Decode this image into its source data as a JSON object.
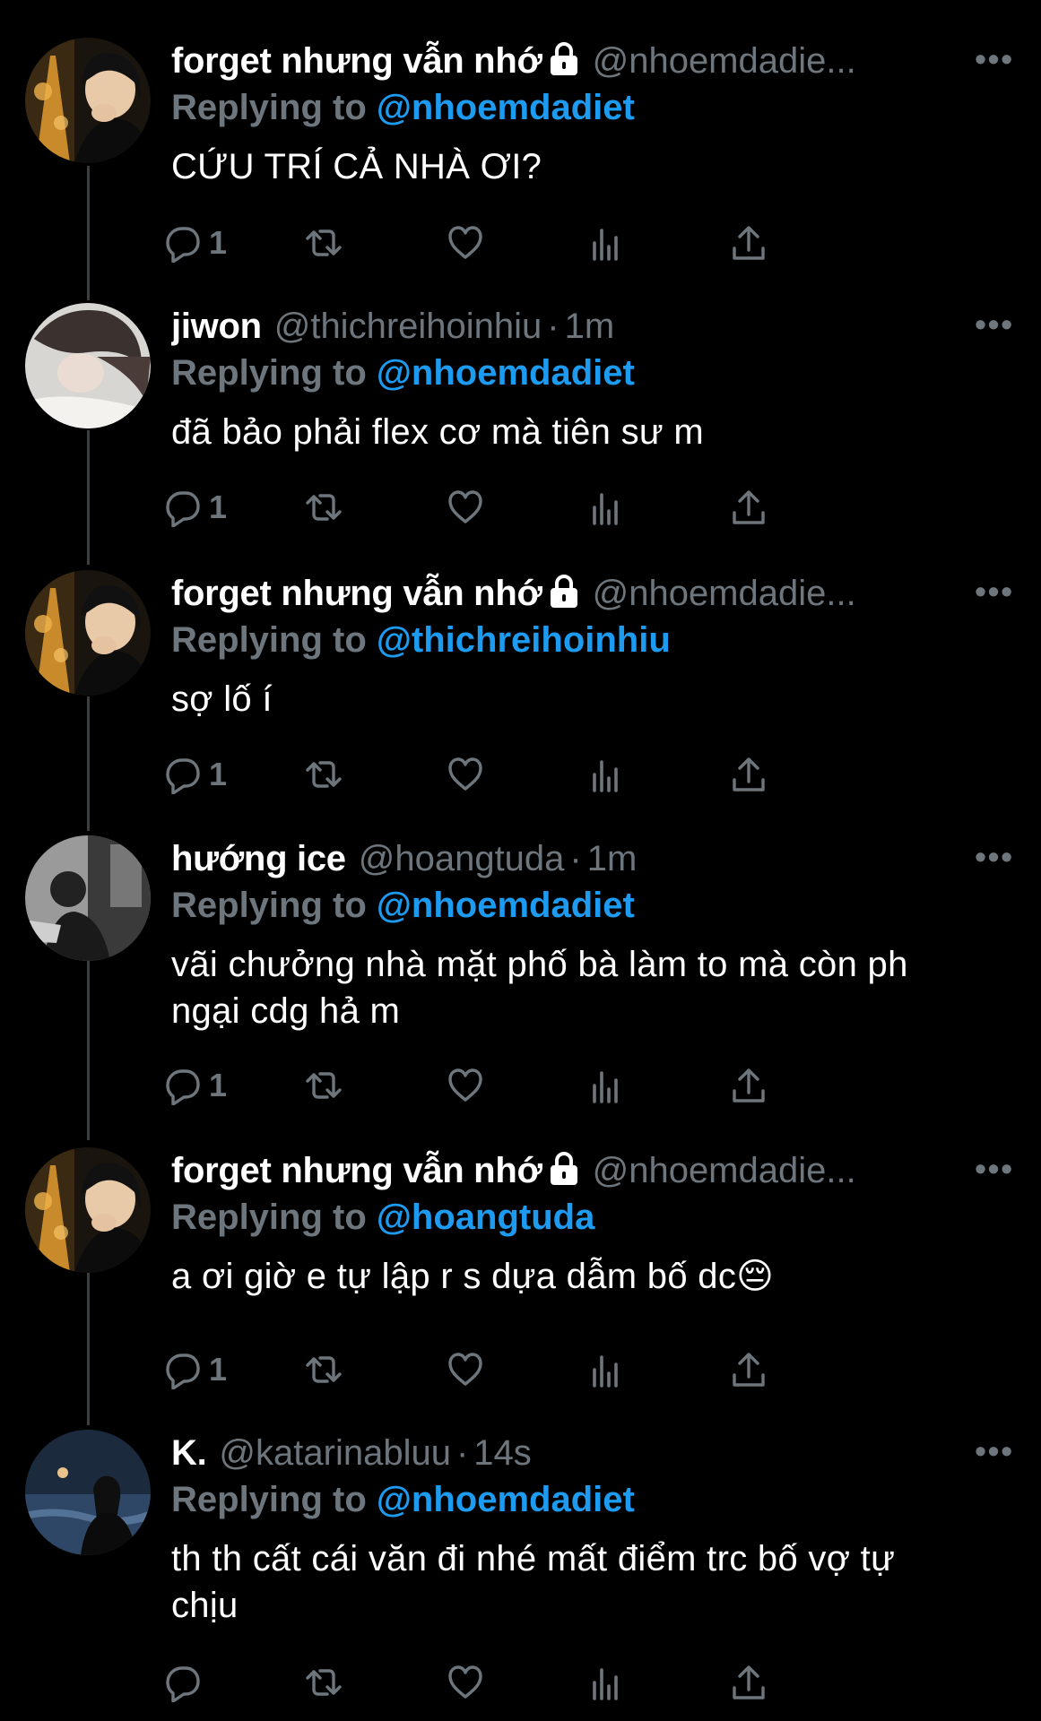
{
  "thread": [
    {
      "name": "forget nhưng vẫn nhớ",
      "locked": true,
      "handle": "@nhoemdadie...",
      "time": "",
      "replying_label": "Replying to",
      "replying_to": "@nhoemdadiet",
      "text_lines": [
        "CỨU TRÍ CẢ NHÀ ƠI?"
      ],
      "reply_count": "1",
      "avatar": "city-night"
    },
    {
      "name": "jiwon",
      "locked": false,
      "handle": "@thichreihoinhiu",
      "time": "1m",
      "replying_label": "Replying to",
      "replying_to": "@nhoemdadiet",
      "text_lines": [
        "đã bảo phải flex cơ mà tiên sư m"
      ],
      "reply_count": "1",
      "avatar": "girl-white"
    },
    {
      "name": "forget nhưng vẫn nhớ",
      "locked": true,
      "handle": "@nhoemdadie...",
      "time": "",
      "replying_label": "Replying to",
      "replying_to": "@thichreihoinhiu",
      "text_lines": [
        "sợ lố í"
      ],
      "reply_count": "1",
      "avatar": "city-night"
    },
    {
      "name": "hướng ice",
      "locked": false,
      "handle": "@hoangtuda",
      "time": "1m",
      "replying_label": "Replying to",
      "replying_to": "@nhoemdadiet",
      "text_lines": [
        "vãi chưởng nhà mặt phố bà làm to mà còn ph",
        "ngại cdg hả m"
      ],
      "reply_count": "1",
      "avatar": "bw-room"
    },
    {
      "name": "forget nhưng vẫn nhớ",
      "locked": true,
      "handle": "@nhoemdadie...",
      "time": "",
      "replying_label": "Replying to",
      "replying_to": "@hoangtuda",
      "text_lines": [
        "a ơi giờ e tự lập r s dựa dẫm bố dc😔"
      ],
      "reply_count": "1",
      "avatar": "city-night"
    },
    {
      "name": "K.",
      "locked": false,
      "handle": "@katarinabluu",
      "time": "14s",
      "replying_label": "Replying to",
      "replying_to": "@nhoemdadiet",
      "text_lines": [
        "th th cất cái văn đi nhé mất điểm trc bố vợ tự",
        "chịu"
      ],
      "reply_count": "",
      "avatar": "sea-night"
    }
  ],
  "icons": [
    "reply-icon",
    "retweet-icon",
    "like-icon",
    "analytics-icon",
    "share-icon",
    "more-icon",
    "lock-icon"
  ],
  "colors": {
    "background": "#000000",
    "accent": "#1d9bf0",
    "muted": "#6e767d",
    "text": "#ffffff"
  }
}
